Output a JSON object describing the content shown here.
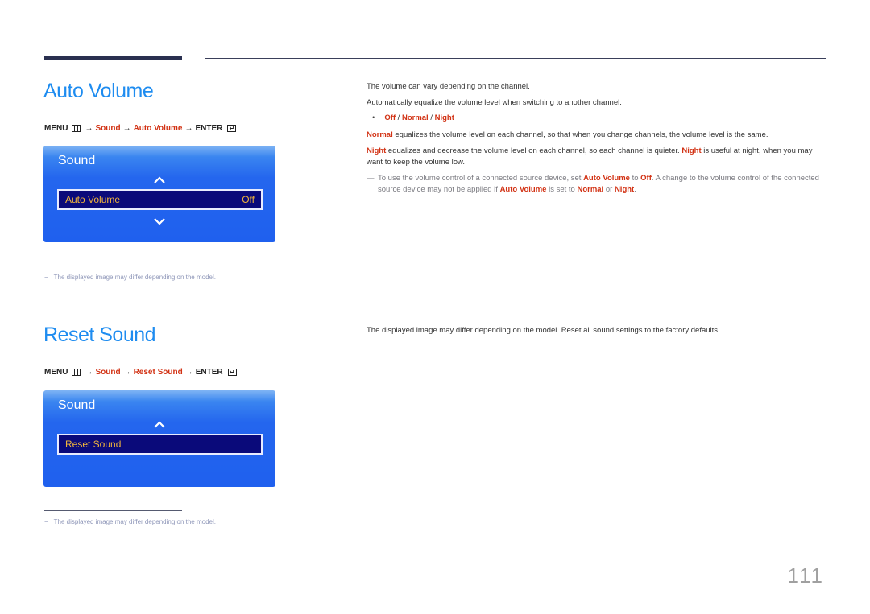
{
  "page_number": "111",
  "auto_volume": {
    "title": "Auto Volume",
    "menu_path": {
      "menu": "MENU",
      "arrow": "→",
      "step1": "Sound",
      "step2": "Auto Volume",
      "enter": "ENTER",
      "enter_icon_glyph": "↵"
    },
    "osd": {
      "title": "Sound",
      "item_label": "Auto Volume",
      "item_value": "Off"
    },
    "footnote": {
      "dash": "−",
      "text": "The displayed image may differ depending on the model."
    },
    "desc1": "The volume can vary depending on the channel.",
    "desc2": "Automatically equalize the volume level when switching to another channel.",
    "bullet": {
      "mark": "•",
      "opt1": "Off",
      "sep": " / ",
      "opt2": "Normal",
      "opt3": "Night"
    },
    "normal_para": {
      "term": "Normal",
      "text": " equalizes the volume level on each channel, so that when you change channels, the volume level is the same."
    },
    "night_para": {
      "term": "Night",
      "text1": " equalizes and decrease the volume level on each channel, so each channel is quieter. ",
      "term2": "Night",
      "text2": " is useful at night, when you may want to keep the volume low."
    },
    "note": {
      "dash": "—",
      "t1": "To use the volume control of a connected source device, set ",
      "h1": "Auto Volume",
      "t2": " to ",
      "h2": "Off",
      "t3": ". A change to the volume control of the connected source device may not be applied if ",
      "h3": "Auto Volume",
      "t4": " is set to ",
      "h4": "Normal",
      "t5": " or ",
      "h5": "Night",
      "t6": "."
    }
  },
  "reset_sound": {
    "title": "Reset Sound",
    "menu_path": {
      "menu": "MENU",
      "arrow": "→",
      "step1": "Sound",
      "step2": "Reset Sound",
      "enter": "ENTER",
      "enter_icon_glyph": "↵"
    },
    "osd": {
      "title": "Sound",
      "item_label": "Reset Sound"
    },
    "footnote": {
      "dash": "−",
      "text": "The displayed image may differ depending on the model."
    },
    "desc": "The displayed image may differ depending on the model. Reset all sound settings to the factory defaults."
  },
  "colors": {
    "title_blue": "#1e8cf0",
    "highlight_red": "#d23214",
    "osd_blue": "#2466ee",
    "osd_selected": "#0a0a7a",
    "osd_text": "#f0b43c"
  }
}
